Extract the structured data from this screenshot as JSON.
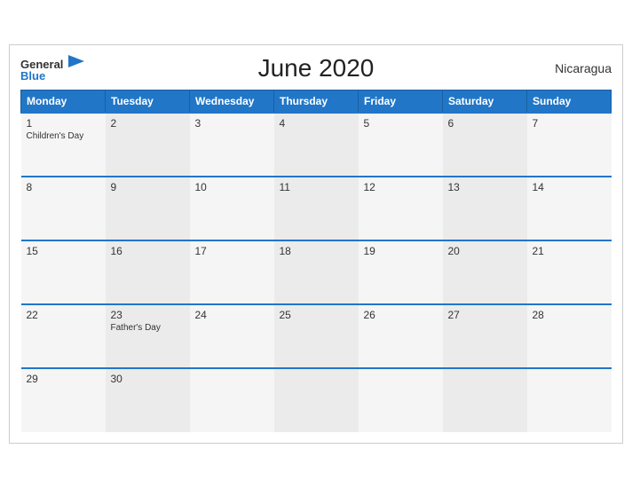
{
  "brand": {
    "general": "General",
    "blue": "Blue"
  },
  "header": {
    "title": "June 2020",
    "country": "Nicaragua"
  },
  "columns": [
    "Monday",
    "Tuesday",
    "Wednesday",
    "Thursday",
    "Friday",
    "Saturday",
    "Sunday"
  ],
  "weeks": [
    [
      {
        "day": "1",
        "holiday": "Children's Day"
      },
      {
        "day": "2",
        "holiday": ""
      },
      {
        "day": "3",
        "holiday": ""
      },
      {
        "day": "4",
        "holiday": ""
      },
      {
        "day": "5",
        "holiday": ""
      },
      {
        "day": "6",
        "holiday": ""
      },
      {
        "day": "7",
        "holiday": ""
      }
    ],
    [
      {
        "day": "8",
        "holiday": ""
      },
      {
        "day": "9",
        "holiday": ""
      },
      {
        "day": "10",
        "holiday": ""
      },
      {
        "day": "11",
        "holiday": ""
      },
      {
        "day": "12",
        "holiday": ""
      },
      {
        "day": "13",
        "holiday": ""
      },
      {
        "day": "14",
        "holiday": ""
      }
    ],
    [
      {
        "day": "15",
        "holiday": ""
      },
      {
        "day": "16",
        "holiday": ""
      },
      {
        "day": "17",
        "holiday": ""
      },
      {
        "day": "18",
        "holiday": ""
      },
      {
        "day": "19",
        "holiday": ""
      },
      {
        "day": "20",
        "holiday": ""
      },
      {
        "day": "21",
        "holiday": ""
      }
    ],
    [
      {
        "day": "22",
        "holiday": ""
      },
      {
        "day": "23",
        "holiday": "Father's Day"
      },
      {
        "day": "24",
        "holiday": ""
      },
      {
        "day": "25",
        "holiday": ""
      },
      {
        "day": "26",
        "holiday": ""
      },
      {
        "day": "27",
        "holiday": ""
      },
      {
        "day": "28",
        "holiday": ""
      }
    ],
    [
      {
        "day": "29",
        "holiday": ""
      },
      {
        "day": "30",
        "holiday": ""
      },
      {
        "day": "",
        "holiday": ""
      },
      {
        "day": "",
        "holiday": ""
      },
      {
        "day": "",
        "holiday": ""
      },
      {
        "day": "",
        "holiday": ""
      },
      {
        "day": "",
        "holiday": ""
      }
    ]
  ]
}
